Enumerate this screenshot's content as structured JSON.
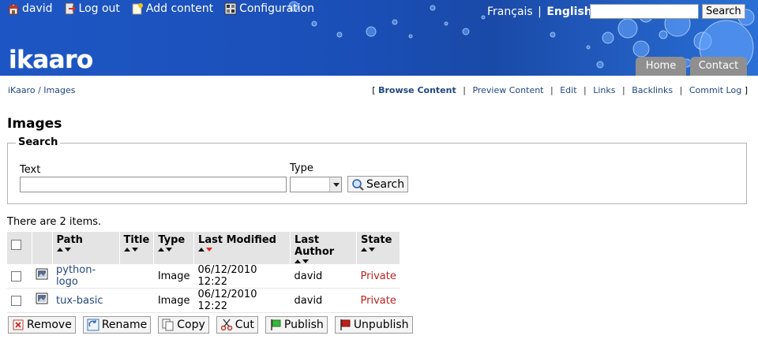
{
  "top_menu": {
    "user": "david",
    "logout": "Log out",
    "add_content": "Add content",
    "configuration": "Configuration"
  },
  "languages": {
    "french": "Français",
    "separator": "|",
    "english": "English"
  },
  "top_search": {
    "value": "",
    "button": "Search"
  },
  "logo": "ikaaro",
  "nav_tabs": {
    "home": "Home",
    "contact": "Contact"
  },
  "breadcrumb": {
    "root": "iKaaro",
    "separator": "/",
    "current": "Images"
  },
  "views": {
    "bracket_open": "[",
    "bracket_close": "]",
    "items": [
      "Browse Content",
      "Preview Content",
      "Edit",
      "Links",
      "Backlinks",
      "Commit Log"
    ]
  },
  "page_title": "Images",
  "search_form": {
    "legend": "Search",
    "text_label": "Text",
    "text_value": "",
    "type_label": "Type",
    "type_value": "",
    "button": "Search"
  },
  "results": {
    "count_text": "There are 2 items.",
    "columns": [
      "Path",
      "Title",
      "Type",
      "Last Modified",
      "Last Author",
      "State"
    ],
    "rows": [
      {
        "path": "python-logo",
        "title": "",
        "type": "Image",
        "modified": "06/12/2010 12:22",
        "author": "david",
        "state": "Private"
      },
      {
        "path": "tux-basic",
        "title": "",
        "type": "Image",
        "modified": "06/12/2010 12:22",
        "author": "david",
        "state": "Private"
      }
    ]
  },
  "actions": {
    "remove": "Remove",
    "rename": "Rename",
    "copy": "Copy",
    "cut": "Cut",
    "publish": "Publish",
    "unpublish": "Unpublish"
  },
  "colors": {
    "header_blue": "#1b4fb8",
    "link_blue": "#22477f",
    "private_red": "#c02020",
    "tab_gray": "#8f8f8f"
  }
}
